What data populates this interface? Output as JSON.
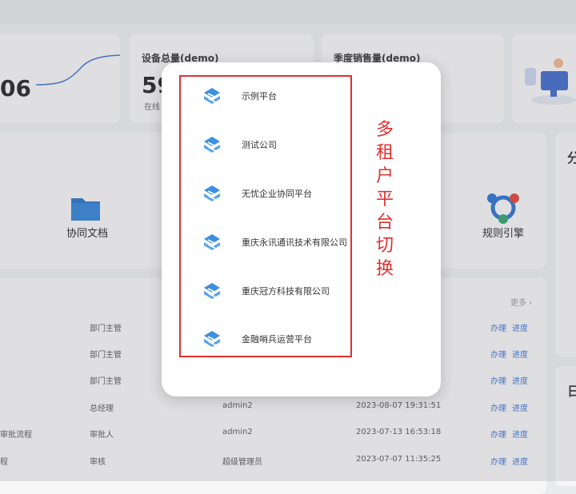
{
  "background": {
    "stats": [
      {
        "title": "",
        "value": "06",
        "sub": ""
      },
      {
        "title": "设备总量(demo)",
        "value": "59",
        "sub": "在线"
      },
      {
        "title": "季度销售量(demo)",
        "value": "",
        "sub": ""
      }
    ],
    "shortcuts": [
      {
        "label": "协同文档",
        "icon": "folder-icon"
      },
      {
        "label": "规则引擎",
        "icon": "share-nodes-icon"
      }
    ],
    "right_heading_1": "分",
    "right_heading_2": "日",
    "more_label": "更多 ›",
    "table_rows": [
      {
        "name": "",
        "role": "部门主管",
        "user": "",
        "time": "",
        "action1": "办理",
        "action2": "进度"
      },
      {
        "name": "",
        "role": "部门主管",
        "user": "",
        "time": "",
        "action1": "办理",
        "action2": "进度"
      },
      {
        "name": "",
        "role": "部门主管",
        "user": "",
        "time": "",
        "action1": "办理",
        "action2": "进度"
      },
      {
        "name": "",
        "role": "总经理",
        "user": "admin2",
        "time": "2023-08-07 19:31:51",
        "action1": "办理",
        "action2": "进度"
      },
      {
        "name": "审批流程",
        "role": "审批人",
        "user": "admin2",
        "time": "2023-07-13 16:53:18",
        "action1": "办理",
        "action2": "进度"
      },
      {
        "name": "程",
        "role": "审核",
        "user": "超级管理员",
        "time": "2023-07-07 11:35:25",
        "action1": "办理",
        "action2": "进度"
      }
    ]
  },
  "modal": {
    "tenants": [
      {
        "name": "示例平台"
      },
      {
        "name": "测试公司"
      },
      {
        "name": "无忧企业协同平台"
      },
      {
        "name": "重庆永讯通讯技术有限公司"
      },
      {
        "name": "重庆冠方科技有限公司"
      },
      {
        "name": "金融哨兵运营平台"
      }
    ],
    "annotation_chars": [
      "多",
      "租",
      "户",
      "平",
      "台",
      "切",
      "换"
    ],
    "accent": "#3d8fe0",
    "annotation_color": "#e03030"
  }
}
